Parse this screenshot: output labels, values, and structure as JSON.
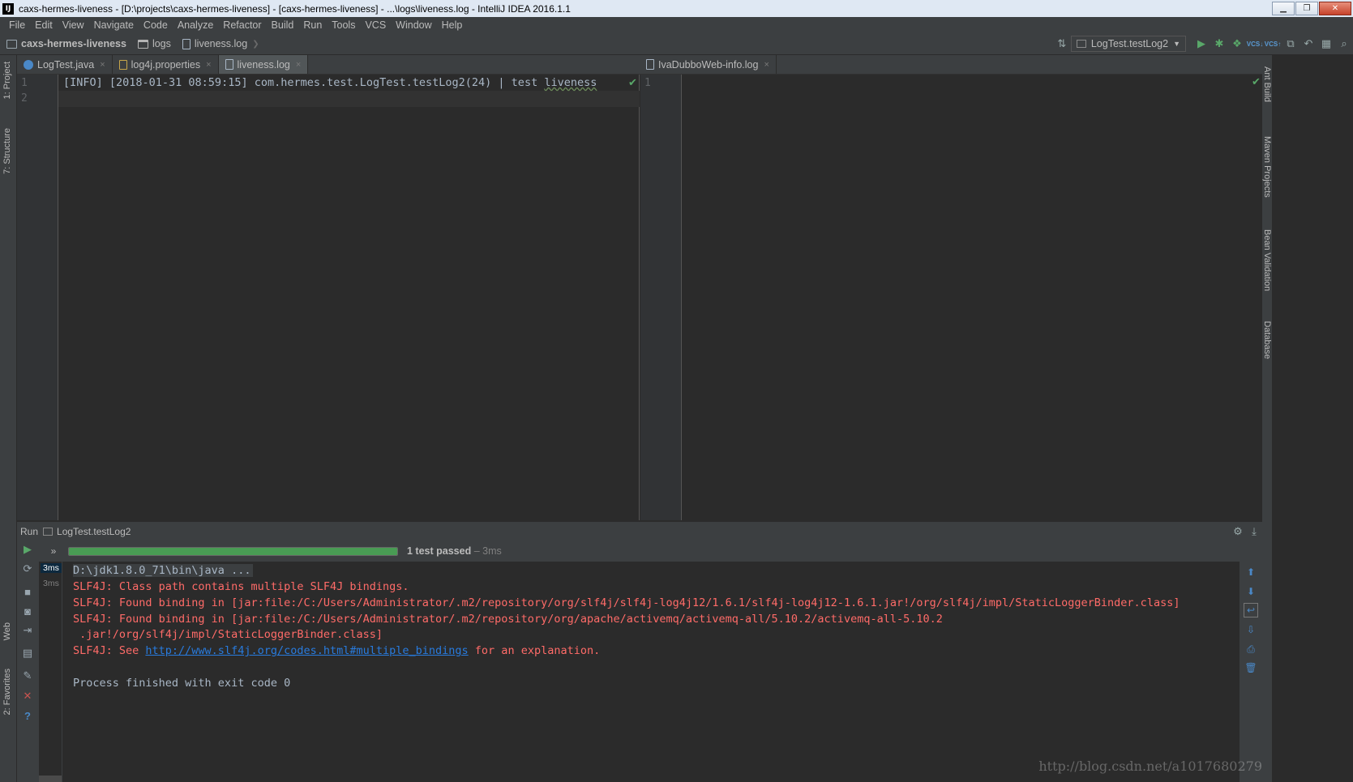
{
  "window": {
    "title": "caxs-hermes-liveness - [D:\\projects\\caxs-hermes-liveness] - [caxs-hermes-liveness] - ...\\logs\\liveness.log - IntelliJ IDEA 2016.1.1",
    "app_icon": "IJ",
    "controls": [
      "minimize",
      "maximize",
      "close"
    ]
  },
  "menu": [
    "File",
    "Edit",
    "View",
    "Navigate",
    "Code",
    "Analyze",
    "Refactor",
    "Build",
    "Run",
    "Tools",
    "VCS",
    "Window",
    "Help"
  ],
  "breadcrumbs": [
    "caxs-hermes-liveness",
    "logs",
    "liveness.log"
  ],
  "run_config": "LogTest.testLog2",
  "left_strip": [
    "1: Project",
    "7: Structure",
    "Web",
    "2: Favorites"
  ],
  "right_strip": [
    "Ant Build",
    "Maven Projects",
    "Bean Validation",
    "Database"
  ],
  "tabs_left": [
    {
      "label": "LogTest.java",
      "kind": "java"
    },
    {
      "label": "log4j.properties",
      "kind": "props"
    },
    {
      "label": "liveness.log",
      "kind": "log",
      "active": true
    }
  ],
  "tabs_right": [
    {
      "label": "IvaDubboWeb-info.log",
      "kind": "log"
    }
  ],
  "editor_left": {
    "line_numbers": [
      "1",
      "2"
    ],
    "line1": "[INFO] [2018-01-31 08:59:15] com.hermes.test.LogTest.testLog2(24) | test ",
    "line1_word": "liveness"
  },
  "editor_right": {
    "line_numbers": [
      "1"
    ]
  },
  "run_panel": {
    "label": "Run",
    "config": "LogTest.testLog2",
    "status": "1 test passed",
    "time_sep": " – ",
    "time": "3ms",
    "progress": 1.0,
    "tree": [
      {
        "label": "3ms",
        "selected": true
      },
      {
        "label": "3ms",
        "selected": false
      }
    ],
    "console": {
      "cmd": "D:\\jdk1.8.0_71\\bin\\java ...",
      "err1": "SLF4J: Class path contains multiple SLF4J bindings.",
      "err2": "SLF4J: Found binding in [jar:file:/C:/Users/Administrator/.m2/repository/org/slf4j/slf4j-log4j12/1.6.1/slf4j-log4j12-1.6.1.jar!/org/slf4j/impl/StaticLoggerBinder.class]",
      "err3": "SLF4J: Found binding in [jar:file:/C:/Users/Administrator/.m2/repository/org/apache/activemq/activemq-all/5.10.2/activemq-all-5.10.2",
      "err3b": " .jar!/org/slf4j/impl/StaticLoggerBinder.class]",
      "err4_pre": "SLF4J: See ",
      "err4_link": "http://www.slf4j.org/codes.html#multiple_bindings",
      "err4_post": " for an explanation.",
      "exit": "Process finished with exit code 0"
    }
  },
  "watermark": "http://blog.csdn.net/a1017680279",
  "colors": {
    "background": "#2b2b2b",
    "panel": "#3c3f41",
    "error_text": "#ff6b68",
    "link": "#287bde",
    "progress": "#499c54"
  }
}
